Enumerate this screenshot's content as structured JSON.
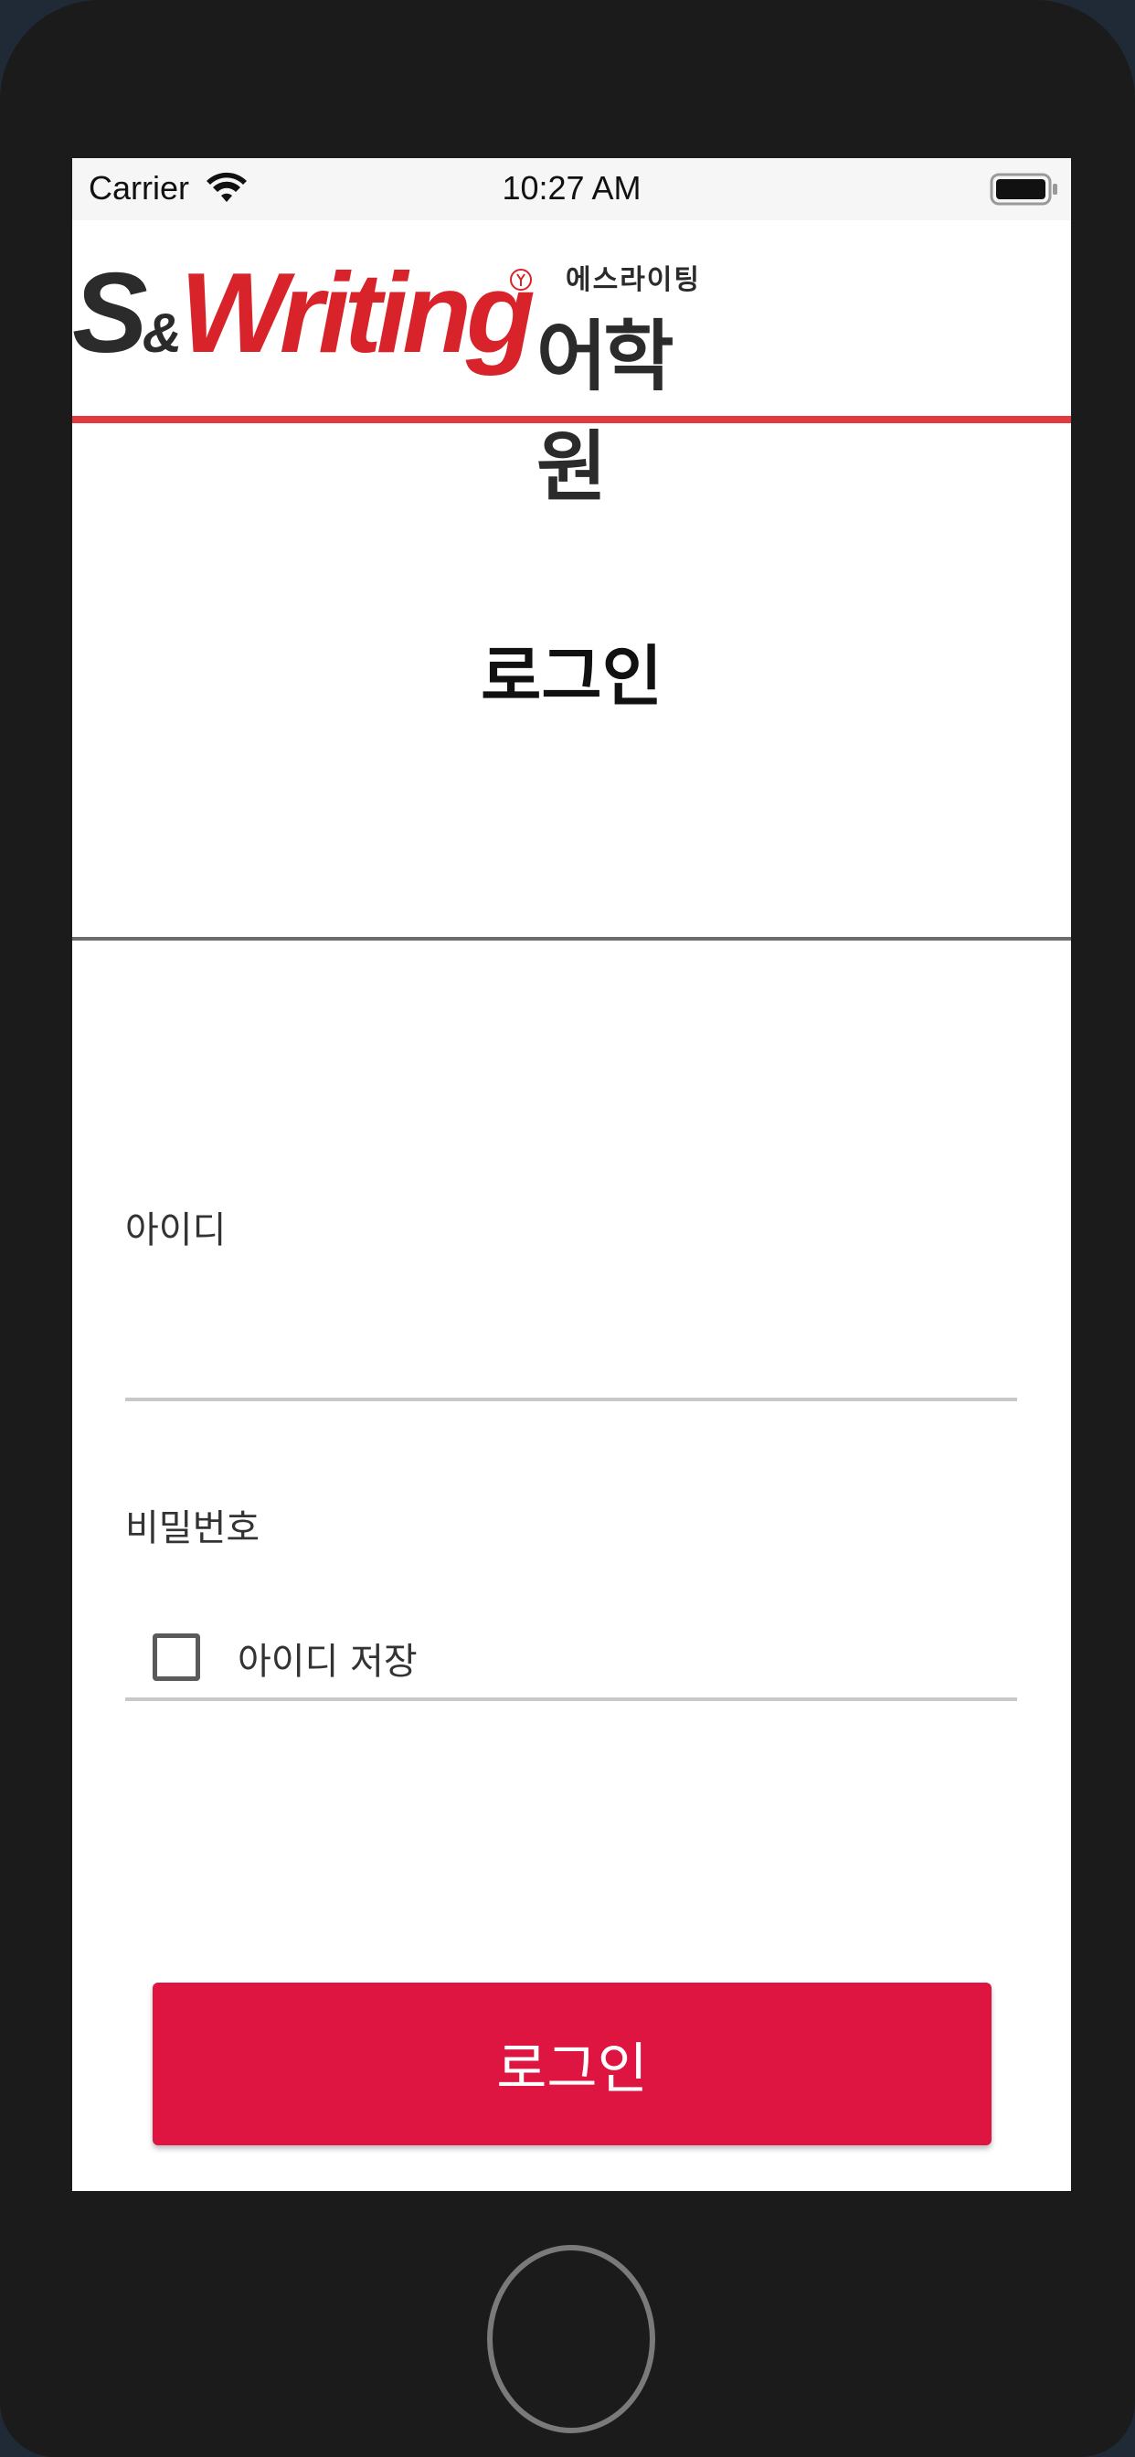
{
  "status_bar": {
    "carrier": "Carrier",
    "time": "10:27 AM",
    "wifi_icon": "wifi-icon",
    "battery_icon": "battery-icon"
  },
  "logo": {
    "main_s": "S",
    "main_amp": "&",
    "main_writing": "Writing",
    "small_text": "에스라이팅",
    "big_text": "어학원",
    "brand_red": "#d8232a",
    "brand_dark": "#2b2b2b"
  },
  "page": {
    "title": "로그인",
    "header_line_color": "#e03a3e"
  },
  "form": {
    "id_label": "아이디",
    "id_value": "",
    "password_label": "비밀번호",
    "password_value": "",
    "remember_label": "아이디 저장",
    "remember_checked": false,
    "login_button": "로그인",
    "button_color": "#dd1540"
  }
}
